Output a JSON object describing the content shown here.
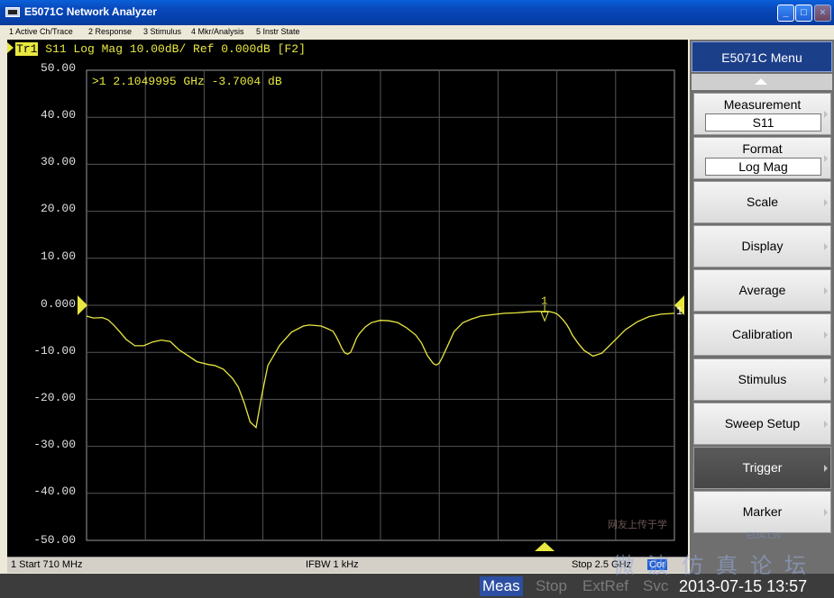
{
  "window": {
    "title": "E5071C Network Analyzer"
  },
  "menubar": [
    "1 Active Ch/Trace",
    "2 Response",
    "3 Stimulus",
    "4 Mkr/Analysis",
    "5 Instr State"
  ],
  "trace": {
    "tag": "Tr1",
    "header": "S11 Log Mag 10.00dB/ Ref 0.000dB [F2]",
    "marker_readout": ">1  2.1049995 GHz -3.7004 dB",
    "marker_label": "1",
    "ref_marker_label": "1",
    "color": "#e8e840"
  },
  "chart_data": {
    "type": "line",
    "ylabel": "",
    "xlabel": "",
    "x_unit": "MHz",
    "xlim": [
      710,
      2500
    ],
    "ylim": [
      -50,
      50
    ],
    "y_ticks": [
      "50.00",
      "40.00",
      "30.00",
      "20.00",
      "10.00",
      "0.000",
      "-10.00",
      "-20.00",
      "-30.00",
      "-40.00",
      "-50.00"
    ],
    "grid": true,
    "divisions_x": 10,
    "series": [
      {
        "values_x": [
          710,
          731,
          758,
          776,
          794,
          812,
          830,
          857,
          884,
          911,
          938,
          965,
          992,
          1010,
          1046,
          1082,
          1100,
          1127,
          1154,
          1172,
          1190,
          1208,
          1226,
          1244,
          1262,
          1298,
          1334,
          1370,
          1388,
          1406,
          1424,
          1442,
          1460,
          1469,
          1478,
          1487,
          1496,
          1505,
          1514,
          1523,
          1532,
          1541,
          1559,
          1577,
          1604,
          1631,
          1658,
          1685,
          1712,
          1730,
          1748,
          1766,
          1775,
          1784,
          1793,
          1811,
          1829,
          1856,
          1883,
          1910,
          1946,
          1982,
          2018,
          2054,
          2081,
          2099,
          2117,
          2135,
          2144,
          2153,
          2162,
          2171,
          2180,
          2189,
          2207,
          2225,
          2252,
          2279,
          2315,
          2351,
          2387,
          2423,
          2459,
          2500
        ],
        "values_y": [
          -2.3,
          -2.7,
          -2.6,
          -3.1,
          -4.3,
          -5.7,
          -7.2,
          -8.6,
          -8.6,
          -7.8,
          -7.4,
          -7.7,
          -9.5,
          -10.3,
          -12.0,
          -12.6,
          -12.8,
          -13.6,
          -15.5,
          -17.4,
          -20.7,
          -24.8,
          -26.0,
          -19.0,
          -12.8,
          -8.5,
          -5.7,
          -4.4,
          -4.2,
          -4.3,
          -4.4,
          -4.9,
          -5.5,
          -6.5,
          -7.7,
          -9.1,
          -10.1,
          -10.4,
          -10.0,
          -8.6,
          -7.0,
          -6.0,
          -4.6,
          -3.7,
          -3.2,
          -3.3,
          -3.7,
          -4.8,
          -6.3,
          -8.0,
          -10.7,
          -12.4,
          -12.7,
          -12.3,
          -11.1,
          -8.4,
          -5.6,
          -3.7,
          -2.9,
          -2.3,
          -2.0,
          -1.7,
          -1.6,
          -1.4,
          -1.3,
          -1.3,
          -1.3,
          -1.6,
          -1.9,
          -2.5,
          -3.2,
          -4.0,
          -5.0,
          -6.3,
          -8.1,
          -9.6,
          -10.8,
          -10.2,
          -7.7,
          -5.2,
          -3.5,
          -2.4,
          -1.9,
          -1.7
        ]
      }
    ]
  },
  "status": {
    "start": "1  Start 710 MHz",
    "ifbw": "IFBW 1 kHz",
    "stop": "Stop 2.5 GHz",
    "cor": "Cor"
  },
  "bottom_bar": {
    "items": [
      "Meas",
      "Stop",
      "ExtRef",
      "Svc"
    ],
    "datetime": "2013-07-15 13:57"
  },
  "menu": {
    "title": "E5071C Menu",
    "measurement": {
      "label": "Measurement",
      "value": "S11"
    },
    "format": {
      "label": "Format",
      "value": "Log Mag"
    },
    "items": [
      "Scale",
      "Display",
      "Average",
      "Calibration",
      "Stimulus",
      "Sweep Setup",
      "Trigger",
      "Marker"
    ]
  },
  "watermark": {
    "top": "网友上传于学",
    "site": "EDA.CN",
    "cn": "微波仿真论坛"
  }
}
